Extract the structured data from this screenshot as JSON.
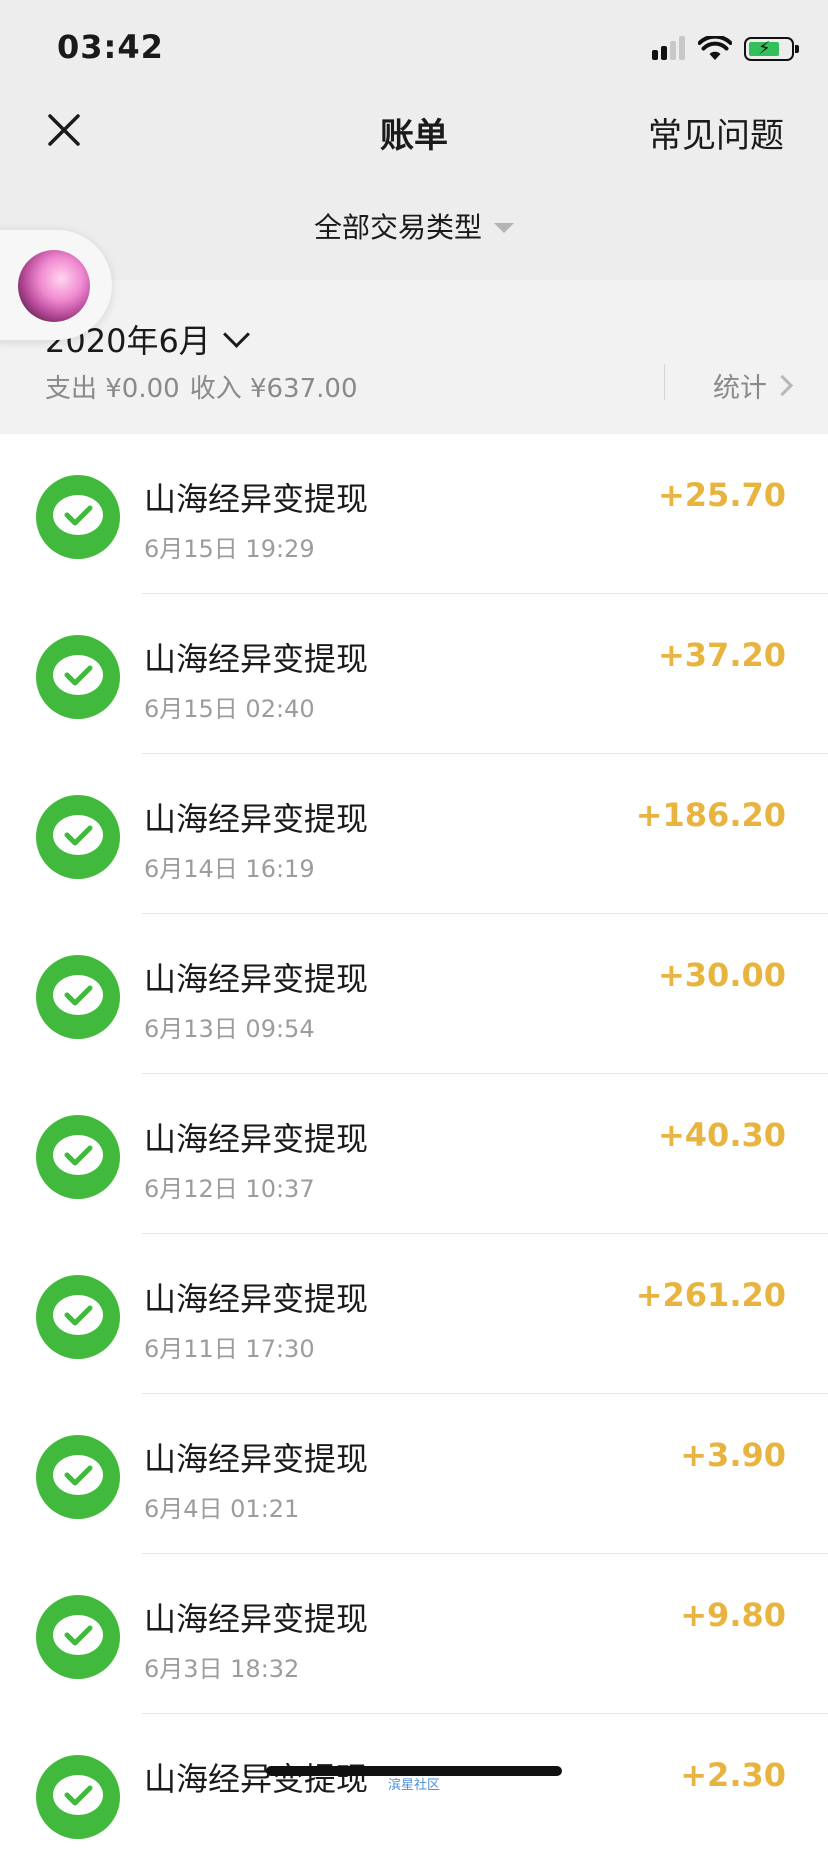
{
  "status_bar": {
    "time": "03:42"
  },
  "nav": {
    "title": "账单",
    "faq_label": "常见问题"
  },
  "filter": {
    "label": "全部交易类型"
  },
  "month": {
    "label": "2020年6月",
    "expense": "支出 ¥0.00",
    "income": "收入 ¥637.00",
    "stats_label": "统计"
  },
  "transactions": [
    {
      "title": "山海经异变提现",
      "time": "6月15日 19:29",
      "amount": "+25.70"
    },
    {
      "title": "山海经异变提现",
      "time": "6月15日 02:40",
      "amount": "+37.20"
    },
    {
      "title": "山海经异变提现",
      "time": "6月14日 16:19",
      "amount": "+186.20"
    },
    {
      "title": "山海经异变提现",
      "time": "6月13日 09:54",
      "amount": "+30.00"
    },
    {
      "title": "山海经异变提现",
      "time": "6月12日 10:37",
      "amount": "+40.30"
    },
    {
      "title": "山海经异变提现",
      "time": "6月11日 17:30",
      "amount": "+261.20"
    },
    {
      "title": "山海经异变提现",
      "time": "6月4日 01:21",
      "amount": "+3.90"
    },
    {
      "title": "山海经异变提现",
      "time": "6月3日 18:32",
      "amount": "+9.80"
    },
    {
      "title": "山海经异变提现",
      "time": "",
      "amount": "+2.30"
    }
  ],
  "watermark": "滨星社区",
  "colors": {
    "amount": "#e8b43f",
    "icon_bg": "#40b93c",
    "header_bg": "#ededed"
  }
}
